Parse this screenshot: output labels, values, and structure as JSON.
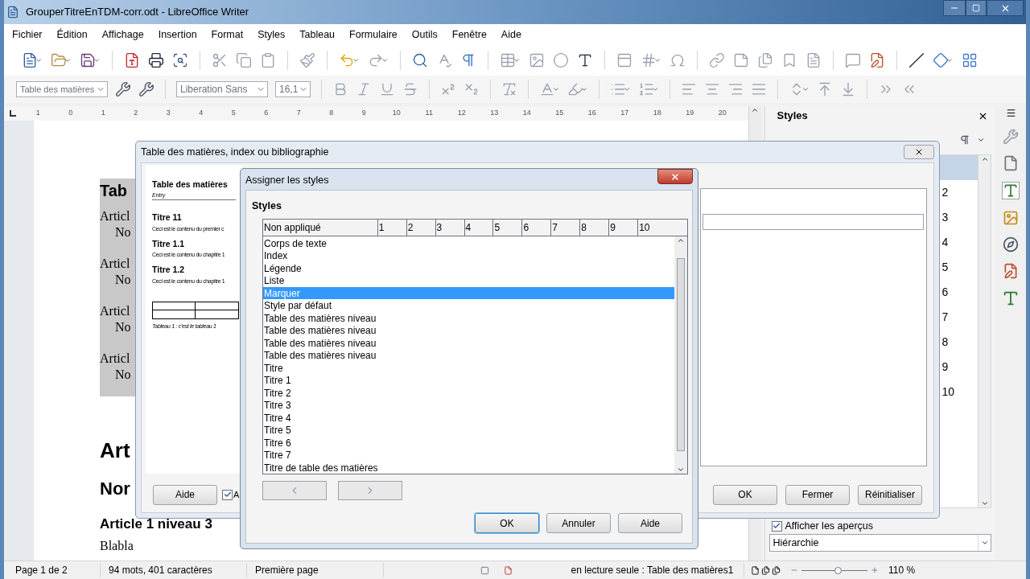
{
  "window": {
    "title": "GrouperTitreEnTDM-corr.odt - LibreOffice Writer"
  },
  "menu": [
    "Fichier",
    "Édition",
    "Affichage",
    "Insertion",
    "Format",
    "Styles",
    "Tableau",
    "Formulaire",
    "Outils",
    "Fenêtre",
    "Aide"
  ],
  "format_bar": {
    "paragraph_style": "Table des matières",
    "font": "Liberation Sans",
    "size": "16,1"
  },
  "ruler": [
    "1",
    "0",
    "1",
    "2",
    "3",
    "4",
    "5",
    "6",
    "7",
    "8",
    "9",
    "10",
    "11",
    "12",
    "13",
    "14",
    "15",
    "16",
    "17",
    "18",
    "19",
    "20"
  ],
  "document": {
    "toc_heading": "Tab",
    "toc_entries": [
      {
        "title": "Articl",
        "sub": "No"
      },
      {
        "title": "Articl",
        "sub": "No"
      },
      {
        "title": "Articl",
        "sub": "No"
      },
      {
        "title": "Articl",
        "sub": "No"
      }
    ],
    "heading_1": "Art",
    "heading_2": "Nor",
    "heading_3": "Article 1 niveau 3",
    "body": "Blabla"
  },
  "toc_dialog": {
    "title": "Table des matières, index ou bibliographie",
    "preview": {
      "title": "Table des matières",
      "entry": "Entry",
      "items": [
        {
          "heading": "Titre 11",
          "text": "Ceci est le contenu du premier c"
        },
        {
          "heading": "Titre 1.1",
          "text": "Ceci est le contenu du chapitre 1"
        },
        {
          "heading": "Titre 1.2",
          "text": "Ceci est le contenu du chapitre 1"
        }
      ],
      "caption": "Tableau 1 : c'est le tableau 1"
    },
    "help": "Aide",
    "checkbox": {
      "label": "A",
      "checked": true
    },
    "buttons": [
      "OK",
      "Fermer",
      "Réinitialiser"
    ]
  },
  "assign_dialog": {
    "title": "Assigner les styles",
    "section": "Styles",
    "columns": [
      "Non appliqué",
      "1",
      "2",
      "3",
      "4",
      "5",
      "6",
      "7",
      "8",
      "9",
      "10"
    ],
    "rows": [
      {
        "label": "Corps de texte",
        "selected": false
      },
      {
        "label": "Index",
        "selected": false
      },
      {
        "label": "Légende",
        "selected": false
      },
      {
        "label": "Liste",
        "selected": false
      },
      {
        "label": "Marquer",
        "selected": true
      },
      {
        "label": "Style par défaut",
        "selected": false
      },
      {
        "label": "Table des matières niveau",
        "selected": false
      },
      {
        "label": "Table des matières niveau",
        "selected": false
      },
      {
        "label": "Table des matières niveau",
        "selected": false
      },
      {
        "label": "Table des matières niveau",
        "selected": false
      },
      {
        "label": "Titre",
        "selected": false
      },
      {
        "label": "Titre 1",
        "selected": false
      },
      {
        "label": "Titre 2",
        "selected": false
      },
      {
        "label": "Titre 3",
        "selected": false
      },
      {
        "label": "Titre 4",
        "selected": false
      },
      {
        "label": "Titre 5",
        "selected": false
      },
      {
        "label": "Titre 6",
        "selected": false
      },
      {
        "label": "Titre 7",
        "selected": false
      },
      {
        "label": "Titre de table des matières",
        "selected": false
      }
    ],
    "buttons": [
      {
        "label": "OK",
        "focused": true
      },
      {
        "label": "Annuler",
        "focused": false
      },
      {
        "label": "Aide",
        "focused": false
      }
    ]
  },
  "styles_panel": {
    "title": "Styles",
    "rows": [
      {
        "selected": true
      },
      {
        "text": "2",
        "selected": false
      },
      {
        "text": "3",
        "selected": false
      },
      {
        "text": "4",
        "selected": false
      },
      {
        "text": "5",
        "selected": false
      },
      {
        "text": "6",
        "selected": false
      },
      {
        "text": "7",
        "selected": false
      },
      {
        "text": "8",
        "selected": false
      },
      {
        "text": "9",
        "selected": false
      },
      {
        "text": "10",
        "selected": false
      }
    ],
    "show_previews": {
      "label": "Afficher les aperçus",
      "checked": true
    },
    "filter": "Hiérarchie"
  },
  "status_bar": {
    "page": "Page 1 de 2",
    "words": "94 mots, 401 caractères",
    "page_style": "Première page",
    "mode": "en lecture seule : Table des matières1",
    "zoom_slider": {
      "level": 0.55
    },
    "zoom": "110 %"
  }
}
